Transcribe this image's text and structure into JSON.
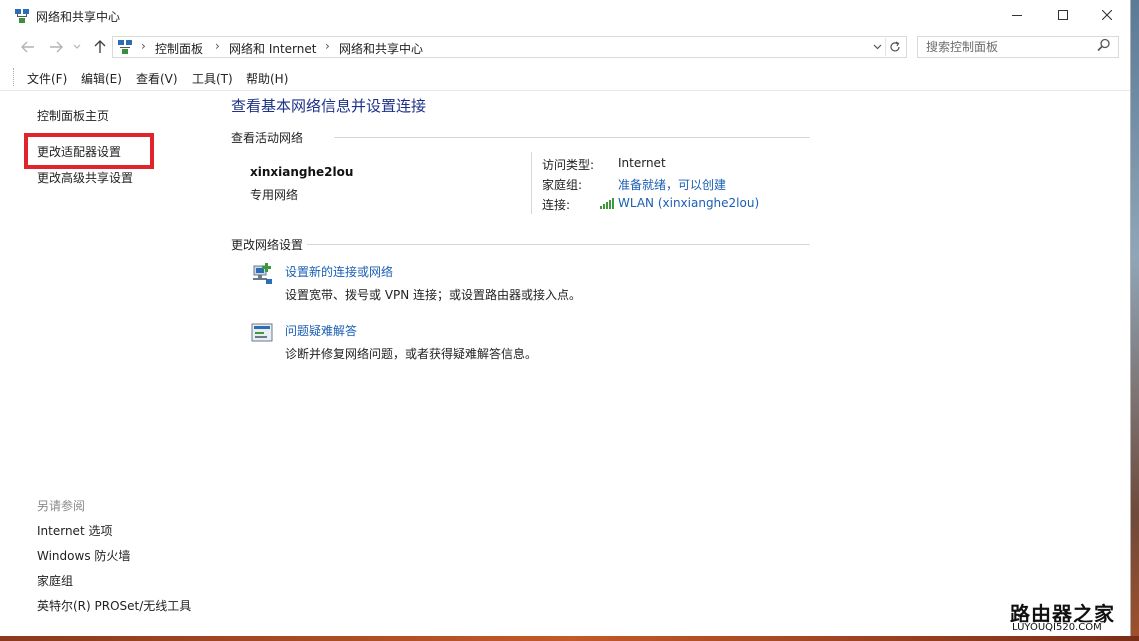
{
  "window": {
    "title": "网络和共享中心",
    "controls": {
      "minimize": "minimize",
      "maximize": "maximize",
      "close": "close"
    }
  },
  "address": {
    "breadcrumbs": [
      "控制面板",
      "网络和 Internet",
      "网络和共享中心"
    ],
    "search_placeholder": "搜索控制面板"
  },
  "menu": [
    "文件(F)",
    "编辑(E)",
    "查看(V)",
    "工具(T)",
    "帮助(H)"
  ],
  "sidebar": {
    "links": [
      "控制面板主页",
      "更改适配器设置",
      "更改高级共享设置"
    ],
    "see_also_title": "另请参阅",
    "see_also": [
      "Internet 选项",
      "Windows 防火墙",
      "家庭组",
      "英特尔(R) PROSet/无线工具"
    ]
  },
  "main": {
    "title": "查看基本网络信息并设置连接",
    "active_networks_heading": "查看活动网络",
    "network_name": "xinxianghe2lou",
    "network_type": "专用网络",
    "access_type_label": "访问类型:",
    "access_type_value": "Internet",
    "homegroup_label": "家庭组:",
    "homegroup_value": "准备就绪，可以创建",
    "connection_label": "连接:",
    "connection_value": "WLAN (xinxianghe2lou)",
    "change_settings_heading": "更改网络设置",
    "tasks": [
      {
        "link": "设置新的连接或网络",
        "desc": "设置宽带、拨号或 VPN 连接；或设置路由器或接入点。"
      },
      {
        "link": "问题疑难解答",
        "desc": "诊断并修复网络问题，或者获得疑难解答信息。"
      }
    ]
  },
  "watermark": {
    "logo": "路由器之家",
    "url": "LUYOUQI520.COM"
  },
  "colors": {
    "link": "#1a5fb4",
    "title": "#1e3287",
    "highlight": "#e0242c"
  }
}
